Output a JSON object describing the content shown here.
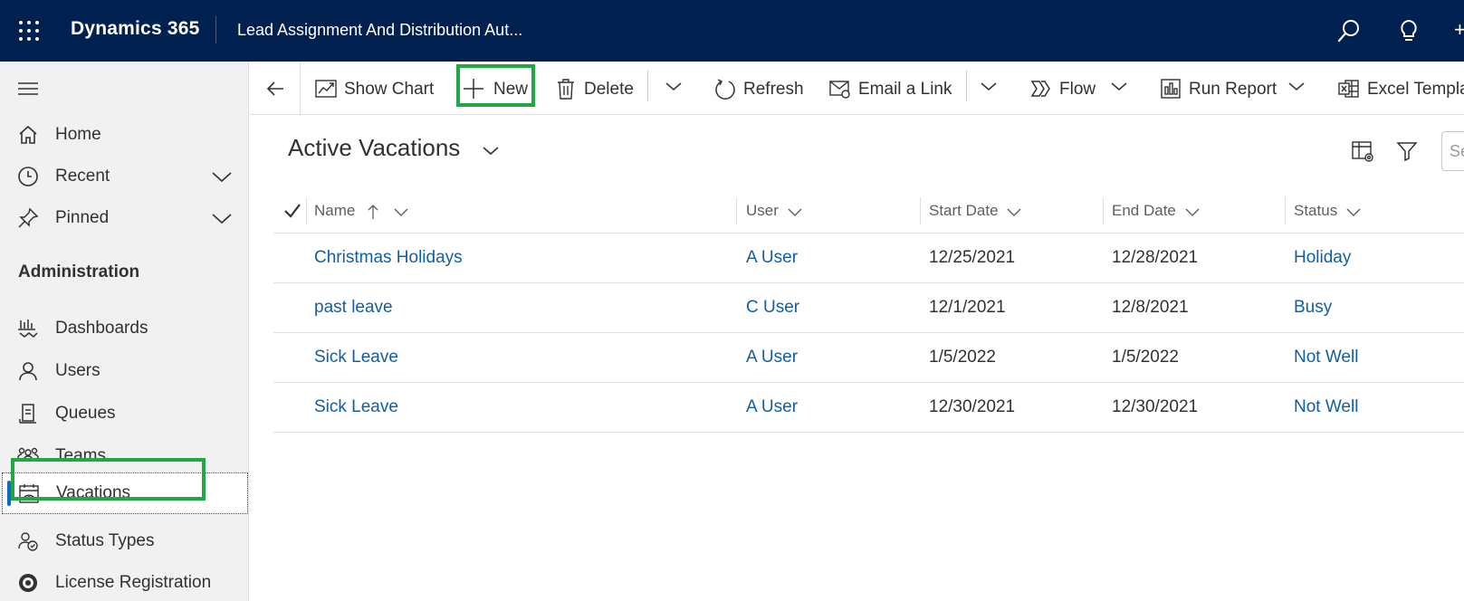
{
  "topbar": {
    "brand": "Dynamics 365",
    "app_name": "Lead Assignment And Distribution Aut...",
    "more": "+"
  },
  "sidebar": {
    "items": [
      {
        "label": "Home",
        "icon": "home-icon"
      },
      {
        "label": "Recent",
        "icon": "clock-icon"
      },
      {
        "label": "Pinned",
        "icon": "pin-icon"
      }
    ],
    "section_title": "Administration",
    "admin_items": [
      {
        "label": "Dashboards",
        "icon": "dashboard-icon"
      },
      {
        "label": "Users",
        "icon": "user-icon"
      },
      {
        "label": "Queues",
        "icon": "queue-icon"
      },
      {
        "label": "Teams",
        "icon": "teams-icon"
      },
      {
        "label": "Vacations",
        "icon": "vacation-icon",
        "selected": true
      },
      {
        "label": "Status Types",
        "icon": "status-types-icon"
      },
      {
        "label": "License Registration",
        "icon": "license-icon"
      }
    ]
  },
  "commands": {
    "show_chart": "Show Chart",
    "new": "New",
    "delete": "Delete",
    "refresh": "Refresh",
    "email_link": "Email a Link",
    "flow": "Flow",
    "run_report": "Run Report",
    "excel_templates": "Excel Templa"
  },
  "view": {
    "title": "Active Vacations",
    "search_placeholder": "Se"
  },
  "grid": {
    "columns": [
      "Name",
      "User",
      "Start Date",
      "End Date",
      "Status"
    ],
    "rows": [
      {
        "name": "Christmas Holidays",
        "user": "A User",
        "start": "12/25/2021",
        "end": "12/28/2021",
        "status": "Holiday"
      },
      {
        "name": "past leave",
        "user": "C User",
        "start": "12/1/2021",
        "end": "12/8/2021",
        "status": "Busy"
      },
      {
        "name": "Sick Leave",
        "user": "A User",
        "start": "1/5/2022",
        "end": "1/5/2022",
        "status": "Not Well"
      },
      {
        "name": "Sick Leave",
        "user": "A User",
        "start": "12/30/2021",
        "end": "12/30/2021",
        "status": "Not Well"
      }
    ]
  },
  "colors": {
    "topbar": "#002050",
    "link": "#115ea3",
    "highlight_box": "#22a745",
    "selected_bar": "#0f6cbd"
  }
}
